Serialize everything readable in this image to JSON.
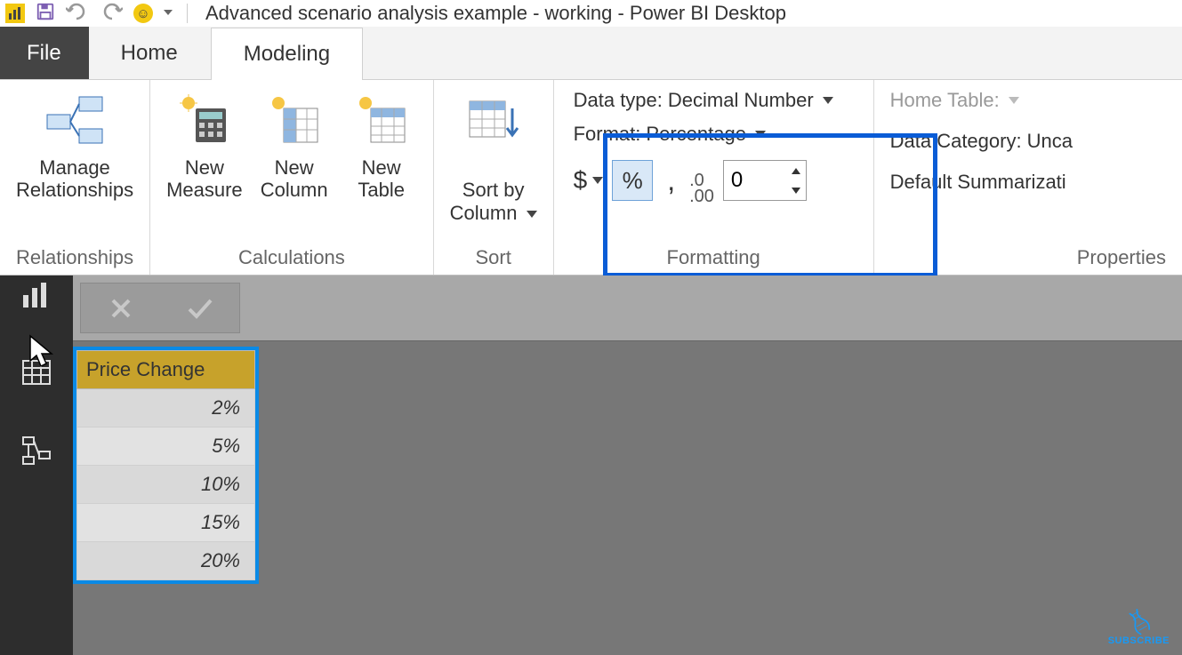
{
  "app": {
    "title": "Advanced scenario analysis example - working - Power BI Desktop"
  },
  "tabs": {
    "file": "File",
    "home": "Home",
    "modeling": "Modeling"
  },
  "ribbon": {
    "relationships": {
      "manage": "Manage\nRelationships",
      "group_label": "Relationships"
    },
    "calculations": {
      "new_measure": "New\nMeasure",
      "new_column": "New\nColumn",
      "new_table": "New\nTable",
      "group_label": "Calculations"
    },
    "sort": {
      "sort_by_column": "Sort by\nColumn",
      "group_label": "Sort"
    },
    "formatting": {
      "data_type_label": "Data type:",
      "data_type_value": "Decimal Number",
      "format_label": "Format:",
      "format_value": "Percentage",
      "currency_symbol": "$",
      "percent_symbol": "%",
      "comma_symbol": ",",
      "decimal_icon": ".0\n.00",
      "decimal_places": "0",
      "group_label": "Formatting"
    },
    "properties": {
      "home_table_label": "Home Table:",
      "data_category_label": "Data Category:",
      "data_category_value": "Unca",
      "default_summarization_label": "Default Summarizati",
      "group_label": "Properties"
    }
  },
  "formula_bar": {
    "cancel": "✕",
    "accept": "✓"
  },
  "table": {
    "header": "Price Change",
    "rows": [
      "2%",
      "5%",
      "10%",
      "15%",
      "20%"
    ]
  },
  "subscribe": "SUBSCRIBE"
}
